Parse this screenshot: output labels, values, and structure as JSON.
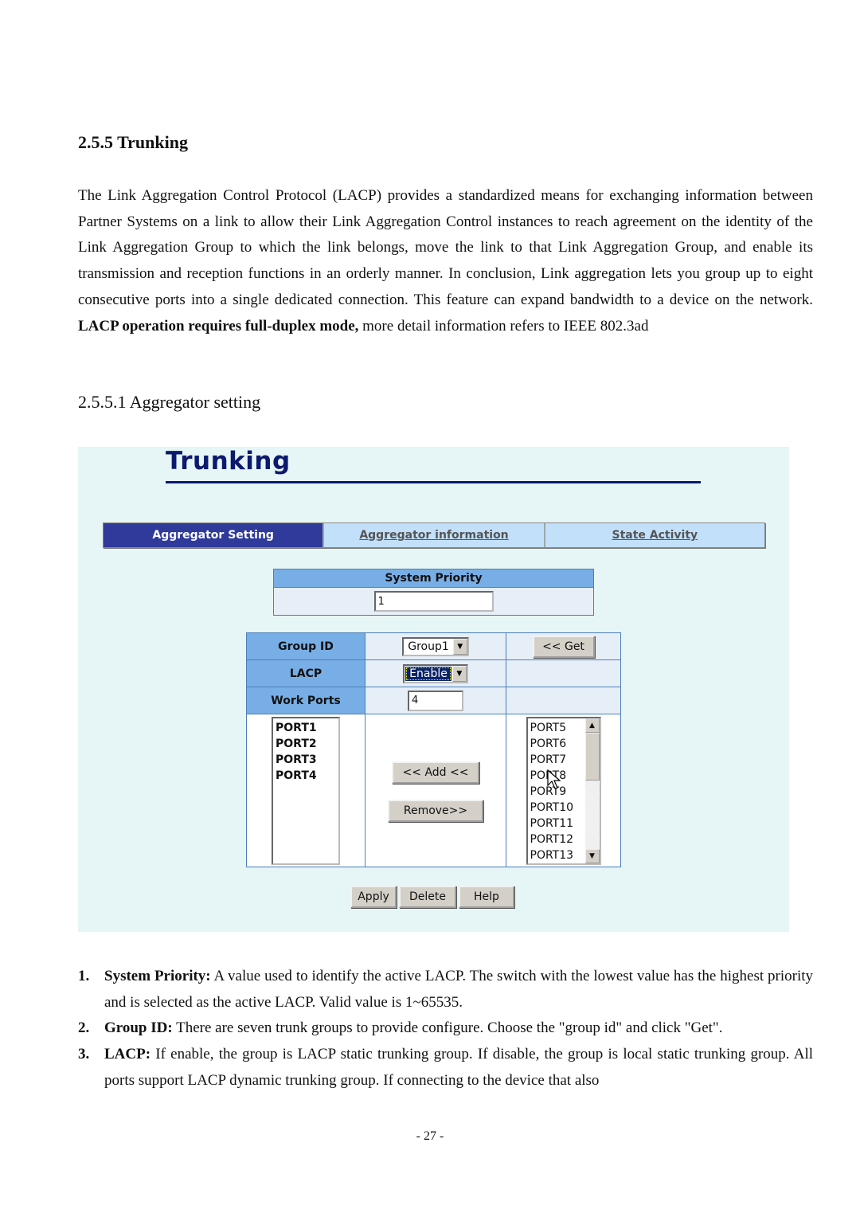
{
  "section_heading": "2.5.5 Trunking",
  "intro": {
    "text": "The Link Aggregation Control Protocol (LACP) provides a standardized means for exchanging information between Partner Systems on a link to allow their Link Aggregation Control instances to reach agreement on the identity of the Link Aggregation Group to which the link belongs, move the link to that Link Aggregation Group, and enable its transmission and reception functions in an orderly manner. In conclusion, Link aggregation lets you group up to eight consecutive ports into a single dedicated connection. This feature can expand bandwidth to a device on the network. ",
    "bold": "LACP operation requires full-duplex mode,",
    "tail": " more detail information refers to IEEE 802.3ad"
  },
  "subsection_heading": "2.5.5.1 Aggregator setting",
  "screenshot": {
    "title": "Trunking",
    "tabs": [
      {
        "label": "Aggregator Setting",
        "active": true
      },
      {
        "label": "Aggregator information",
        "active": false
      },
      {
        "label": "State Activity",
        "active": false
      }
    ],
    "system_priority": {
      "label": "System Priority",
      "value": "1"
    },
    "group_id": {
      "label": "Group ID",
      "selected": "Group1",
      "get_button": "<< Get"
    },
    "lacp": {
      "label": "LACP",
      "selected": "Enable"
    },
    "work_ports": {
      "label": "Work Ports",
      "value": "4"
    },
    "member_ports": [
      "PORT1",
      "PORT2",
      "PORT3",
      "PORT4"
    ],
    "add_button": "<< Add <<",
    "remove_button": "Remove>>",
    "available_ports": [
      "PORT5",
      "PORT6",
      "PORT7",
      "PORT8",
      "PORT9",
      "PORT10",
      "PORT11",
      "PORT12",
      "PORT13"
    ],
    "buttons": {
      "apply": "Apply",
      "delete": "Delete",
      "help": "Help"
    }
  },
  "descriptions": [
    {
      "num": "1.",
      "term": "System Priority:",
      "text": " A value used to identify the active LACP. The switch with the lowest value has the highest priority and is selected as the active LACP. Valid value is 1~65535."
    },
    {
      "num": "2.",
      "term": "Group ID:",
      "text": " There are seven trunk groups to provide configure. Choose the \"group id\" and click \"Get\"."
    },
    {
      "num": "3.",
      "term": "LACP:",
      "text": " If enable, the group is LACP static trunking group. If disable, the group is local static trunking group. All ports support LACP dynamic trunking group. If connecting to the device that also"
    }
  ],
  "page_number": "- 27 -"
}
